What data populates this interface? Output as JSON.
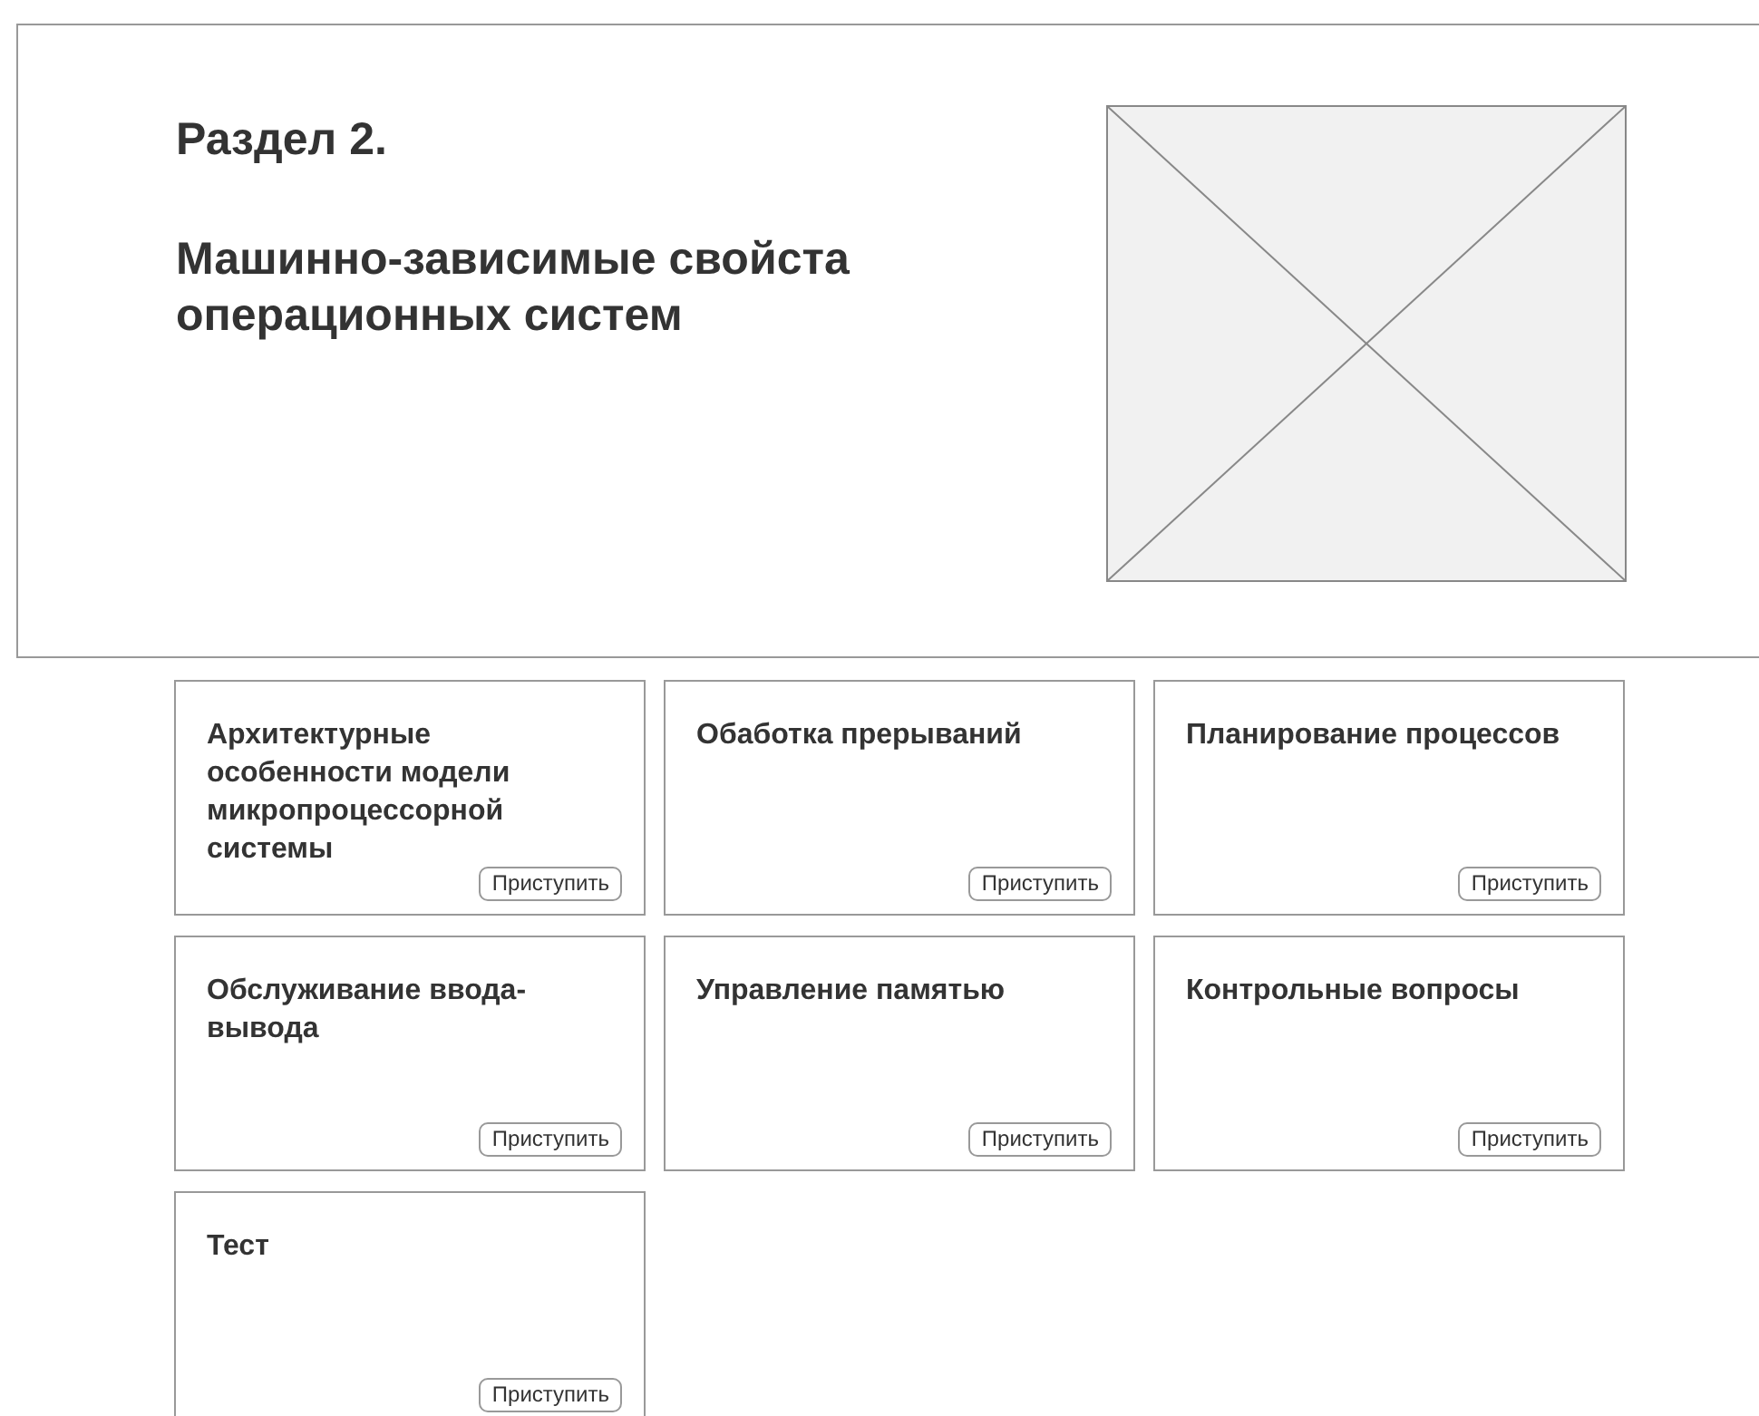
{
  "header": {
    "section": "Раздел 2.",
    "title": "Машинно-зависимые свойста операционных систем"
  },
  "cards": [
    {
      "title": "Архитектурные особенности модели микропроцессорной системы",
      "button": "Приступить"
    },
    {
      "title": "Обаботка прерываний",
      "button": "Приступить"
    },
    {
      "title": "Планирование процессов",
      "button": "Приступить"
    },
    {
      "title": "Обслуживание ввода-вывода",
      "button": "Приступить"
    },
    {
      "title": "Управление памятью",
      "button": "Приступить"
    },
    {
      "title": "Контрольные вопросы",
      "button": "Приступить"
    },
    {
      "title": "Тест",
      "button": "Приступить"
    }
  ]
}
